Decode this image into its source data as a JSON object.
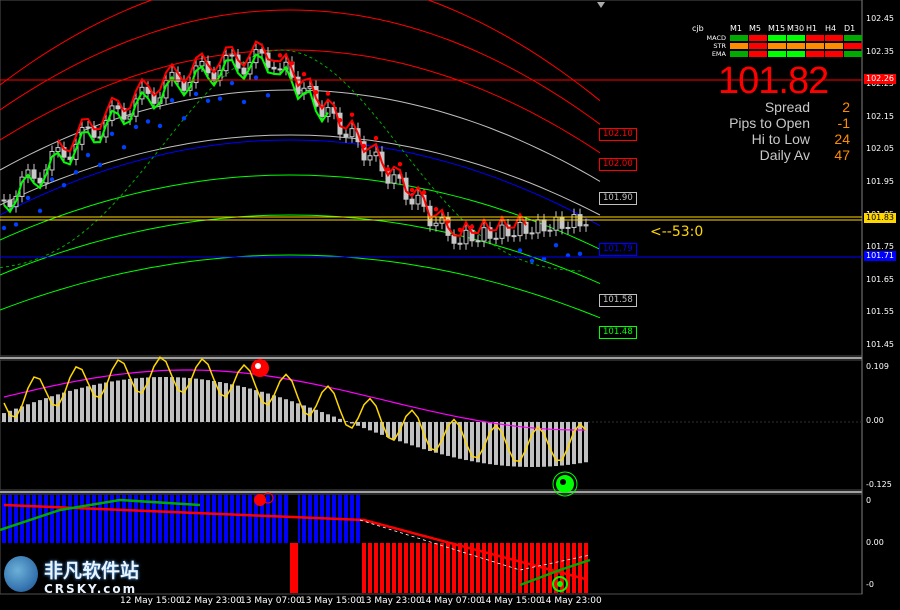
{
  "price_axis": [
    "102.45",
    "102.35",
    "102.25",
    "102.15",
    "102.05",
    "101.95",
    "101.85",
    "101.75",
    "101.65",
    "101.55",
    "101.45"
  ],
  "price_tags": [
    {
      "text": "102.26",
      "bg": "#ff0000",
      "fg": "#ffffff"
    },
    {
      "text": "101.83",
      "bg": "#ffd700",
      "fg": "#000000"
    },
    {
      "text": "101.71",
      "bg": "#0000ff",
      "fg": "#ffffff"
    }
  ],
  "level_boxes": [
    {
      "text": "102.10",
      "color": "#ff0000"
    },
    {
      "text": "102.00",
      "color": "#ff0000"
    },
    {
      "text": "101.90",
      "color": "#c0c0c0"
    },
    {
      "text": "101.79",
      "color": "#0000ff"
    },
    {
      "text": "101.58",
      "color": "#c0c0c0"
    },
    {
      "text": "101.48",
      "color": "#00ff00"
    }
  ],
  "countdown": "<--53:0",
  "info_panel": {
    "corner_label": "cjb",
    "timeframes": [
      "M1",
      "M5",
      "M15",
      "M30",
      "H1",
      "H4",
      "D1"
    ],
    "rows": [
      {
        "name": "MACD",
        "cells": [
          "#00aa00",
          "#ff0000",
          "#00ff00",
          "#00ff00",
          "#ff0000",
          "#ff0000",
          "#00aa00"
        ]
      },
      {
        "name": "STR",
        "cells": [
          "#ff8c00",
          "#ff0000",
          "#ff8c00",
          "#ff8c00",
          "#ff8c00",
          "#ff8c00",
          "#ff0000"
        ]
      },
      {
        "name": "EMA",
        "cells": [
          "#00aa00",
          "#ff0000",
          "#00ff00",
          "#00ff00",
          "#ff0000",
          "#ff0000",
          "#00aa00"
        ]
      }
    ],
    "price": "101.82",
    "stats": [
      {
        "label": "Spread",
        "value": "2",
        "color": "#ff8c00"
      },
      {
        "label": "Pips to Open",
        "value": "-1",
        "color": "#ff8c00"
      },
      {
        "label": "Hi to Low",
        "value": "24",
        "color": "#ff8c00"
      },
      {
        "label": "Daily Av",
        "value": "47",
        "color": "#ff8c00"
      }
    ]
  },
  "ind1_axis": [
    "0.109",
    "0.00",
    "-0.125"
  ],
  "ind2_axis": [
    "0",
    "0.00",
    "-0"
  ],
  "time_axis": [
    "12 May 15:00",
    "12 May 23:00",
    "13 May 07:00",
    "13 May 15:00",
    "13 May 23:00",
    "14 May 07:00",
    "14 May 15:00",
    "14 May 23:00"
  ],
  "watermark": {
    "cn": "非凡软件站",
    "en": "CRSKY.com"
  },
  "colors": {
    "bull_signal": "#ff0000",
    "bear_signal": "#00ff00"
  }
}
